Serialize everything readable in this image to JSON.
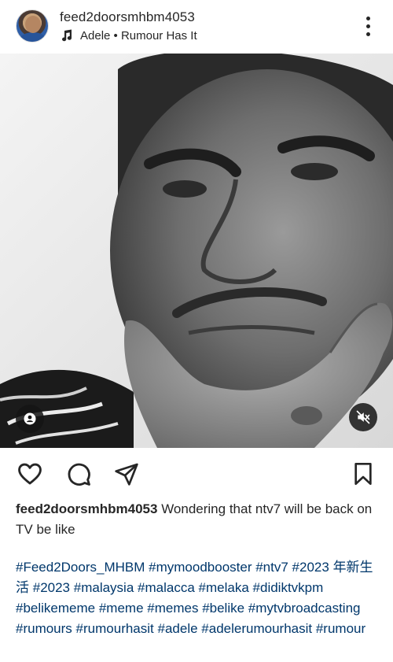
{
  "post": {
    "username": "feed2doorsmhbm4053",
    "audio": "Adele • Rumour Has It",
    "caption_user": "feed2doorsmhbm4053",
    "caption_text": "Wondering that ntv7 will be back on TV be like",
    "hashtags": [
      "#Feed2Doors_MHBM",
      "#mymoodbooster",
      "#ntv7",
      "#2023",
      "年新生活",
      "#2023",
      "#malaysia",
      "#malacca",
      "#melaka",
      "#didiktvkpm",
      "#belikememe",
      "#meme",
      "#memes",
      "#belike",
      "#mytvbroadcasting",
      "#rumours",
      "#rumourhasit",
      "#adele",
      "#adelerumourhasit",
      "#rumour"
    ]
  },
  "icons": {
    "more": "more-vertical-icon",
    "music": "music-note-icon",
    "tagged_users": "user-tag-icon",
    "mute": "speaker-muted-icon",
    "like": "heart-icon",
    "comment": "comment-icon",
    "share": "send-icon",
    "save": "bookmark-icon"
  },
  "colors": {
    "text": "#262626",
    "hashtag": "#00376b",
    "background": "#ffffff"
  }
}
